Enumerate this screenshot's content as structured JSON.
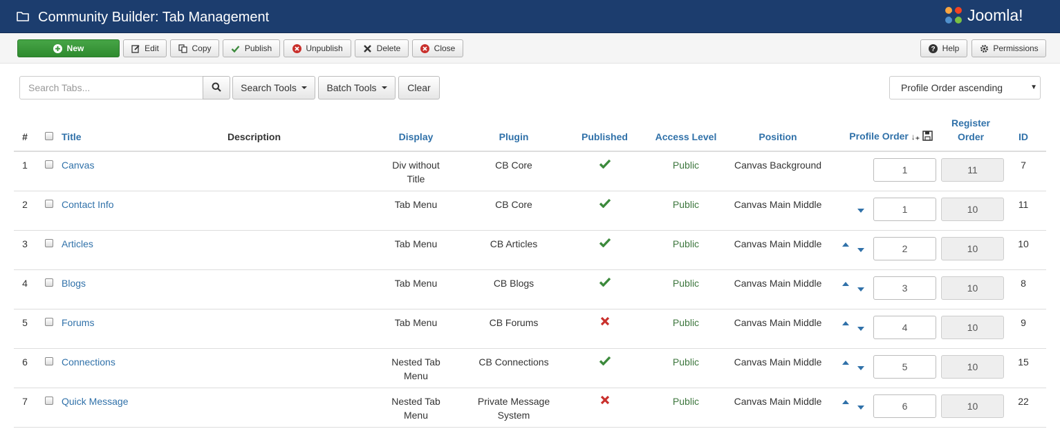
{
  "header": {
    "title": "Community Builder: Tab Management",
    "logo_text": "Joomla!",
    "colors": {
      "bar": "#1c3d6e"
    }
  },
  "toolbar": {
    "new_label": "New",
    "edit_label": "Edit",
    "copy_label": "Copy",
    "publish_label": "Publish",
    "unpublish_label": "Unpublish",
    "delete_label": "Delete",
    "close_label": "Close",
    "help_label": "Help",
    "permissions_label": "Permissions"
  },
  "filters": {
    "search_placeholder": "Search Tabs...",
    "search_tools_label": "Search Tools",
    "batch_tools_label": "Batch Tools",
    "clear_label": "Clear",
    "sort_selected": "Profile Order ascending"
  },
  "table": {
    "headers": {
      "num": "#",
      "title": "Title",
      "description": "Description",
      "display": "Display",
      "plugin": "Plugin",
      "published": "Published",
      "access": "Access Level",
      "position": "Position",
      "profile_order": "Profile Order",
      "register_order": "Register Order",
      "id": "ID"
    },
    "rows": [
      {
        "num": "1",
        "title": "Canvas",
        "description": "",
        "display": "Div without Title",
        "plugin": "CB Core",
        "published": true,
        "access": "Public",
        "position": "Canvas Background",
        "profile_order": "1",
        "register_order": "11",
        "id": "7",
        "up": false,
        "down": false
      },
      {
        "num": "2",
        "title": "Contact Info",
        "description": "",
        "display": "Tab Menu",
        "plugin": "CB Core",
        "published": true,
        "access": "Public",
        "position": "Canvas Main Middle",
        "profile_order": "1",
        "register_order": "10",
        "id": "11",
        "up": false,
        "down": true
      },
      {
        "num": "3",
        "title": "Articles",
        "description": "",
        "display": "Tab Menu",
        "plugin": "CB Articles",
        "published": true,
        "access": "Public",
        "position": "Canvas Main Middle",
        "profile_order": "2",
        "register_order": "10",
        "id": "10",
        "up": true,
        "down": true
      },
      {
        "num": "4",
        "title": "Blogs",
        "description": "",
        "display": "Tab Menu",
        "plugin": "CB Blogs",
        "published": true,
        "access": "Public",
        "position": "Canvas Main Middle",
        "profile_order": "3",
        "register_order": "10",
        "id": "8",
        "up": true,
        "down": true
      },
      {
        "num": "5",
        "title": "Forums",
        "description": "",
        "display": "Tab Menu",
        "plugin": "CB Forums",
        "published": false,
        "access": "Public",
        "position": "Canvas Main Middle",
        "profile_order": "4",
        "register_order": "10",
        "id": "9",
        "up": true,
        "down": true
      },
      {
        "num": "6",
        "title": "Connections",
        "description": "",
        "display": "Nested Tab Menu",
        "plugin": "CB Connections",
        "published": true,
        "access": "Public",
        "position": "Canvas Main Middle",
        "profile_order": "5",
        "register_order": "10",
        "id": "15",
        "up": true,
        "down": true
      },
      {
        "num": "7",
        "title": "Quick Message",
        "description": "",
        "display": "Nested Tab Menu",
        "plugin": "Private Message System",
        "published": false,
        "access": "Public",
        "position": "Canvas Main Middle",
        "profile_order": "6",
        "register_order": "10",
        "id": "22",
        "up": true,
        "down": true
      }
    ]
  },
  "colors": {
    "published_check": "#3c8a3c",
    "unpublished_x": "#c9302c",
    "link": "#3071a9"
  }
}
